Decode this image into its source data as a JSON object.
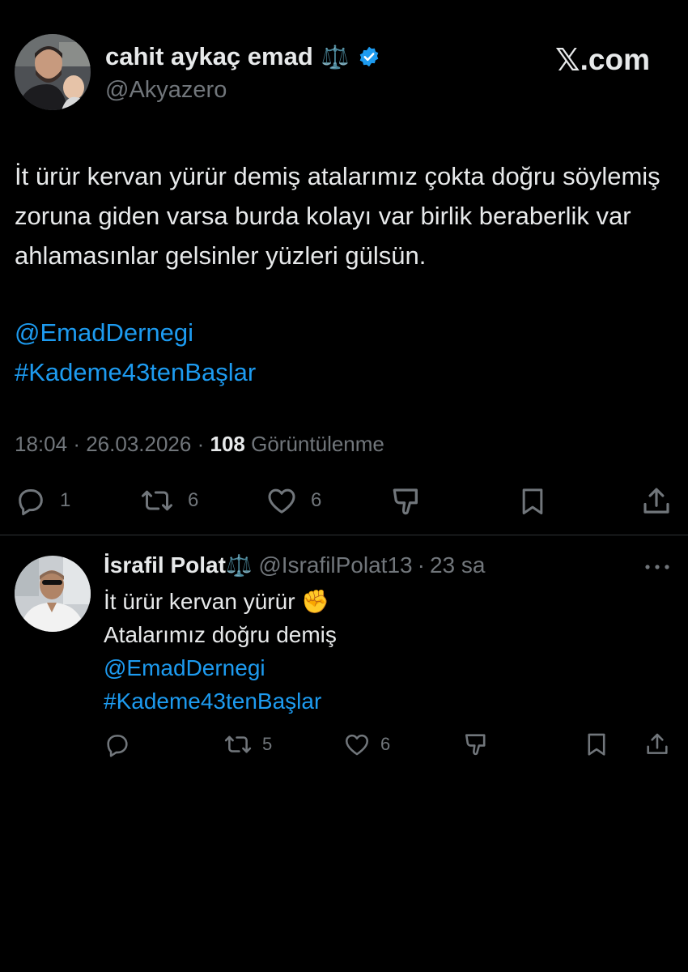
{
  "header": {
    "display_name": "cahit aykaç emad",
    "name_emoji": "⚖️",
    "handle": "@Akyazero",
    "brand_x": "𝕏",
    "brand_domain": ".com"
  },
  "tweet": {
    "text": "İt ürür kervan yürür demiş atalarımız çokta doğru söylemiş zoruna giden varsa burda kolayı var birlik beraberlik var ahlamasınlar gelsinler yüzleri gülsün.",
    "mention": "@EmadDernegi",
    "hashtag": "#Kademe43tenBaşlar",
    "time": "18:04",
    "date": "26.03.2026",
    "views_count": "108",
    "views_label": "Görüntülenme",
    "sep": "·"
  },
  "actions": {
    "replies": "1",
    "retweets": "6",
    "likes": "6"
  },
  "reply": {
    "display_name": "İsrafil Polat",
    "name_emoji": "⚖️",
    "handle": "@IsrafilPolat13",
    "age": "23 sa",
    "sep": "·",
    "line1": "İt ürür kervan yürür ✊",
    "line2": "Atalarımız doğru demiş",
    "mention": "@EmadDernegi",
    "hashtag": "#Kademe43tenBaşlar",
    "retweets": "5",
    "likes": "6"
  },
  "colors": {
    "background": "#000000",
    "text": "#e7e9ea",
    "secondary": "#71767b",
    "link": "#1d9bf0",
    "verified": "#1d9bf0"
  }
}
